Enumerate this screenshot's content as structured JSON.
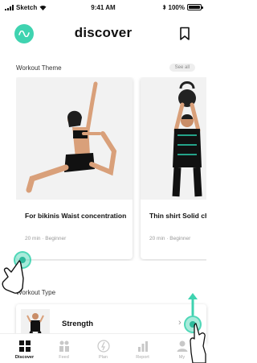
{
  "status_bar": {
    "carrier": "Sketch",
    "time": "9:41 AM",
    "battery": "100%"
  },
  "header": {
    "title": "discover"
  },
  "workout_theme": {
    "title": "Workout Theme",
    "see_all": "See all",
    "cards": [
      {
        "title": "For bikinis Waist concentration",
        "meta": "20 min · Beginner"
      },
      {
        "title": "Thin shirt Solid chest for",
        "meta": "20 min · Beginner"
      }
    ]
  },
  "workout_type": {
    "title": "Workout Type",
    "items": [
      {
        "label": "Strength"
      }
    ]
  },
  "tabbar": {
    "tabs": [
      {
        "label": "Discover",
        "icon": "grid-icon",
        "active": true
      },
      {
        "label": "Feed",
        "icon": "feed-icon",
        "active": false
      },
      {
        "label": "Plan",
        "icon": "plan-icon",
        "active": false
      },
      {
        "label": "Report",
        "icon": "report-icon",
        "active": false
      },
      {
        "label": "My",
        "icon": "person-icon",
        "active": false
      }
    ]
  },
  "colors": {
    "accent": "#3fd3b0",
    "accent_dark": "#2db99b",
    "text": "#111111",
    "muted": "#999999"
  }
}
